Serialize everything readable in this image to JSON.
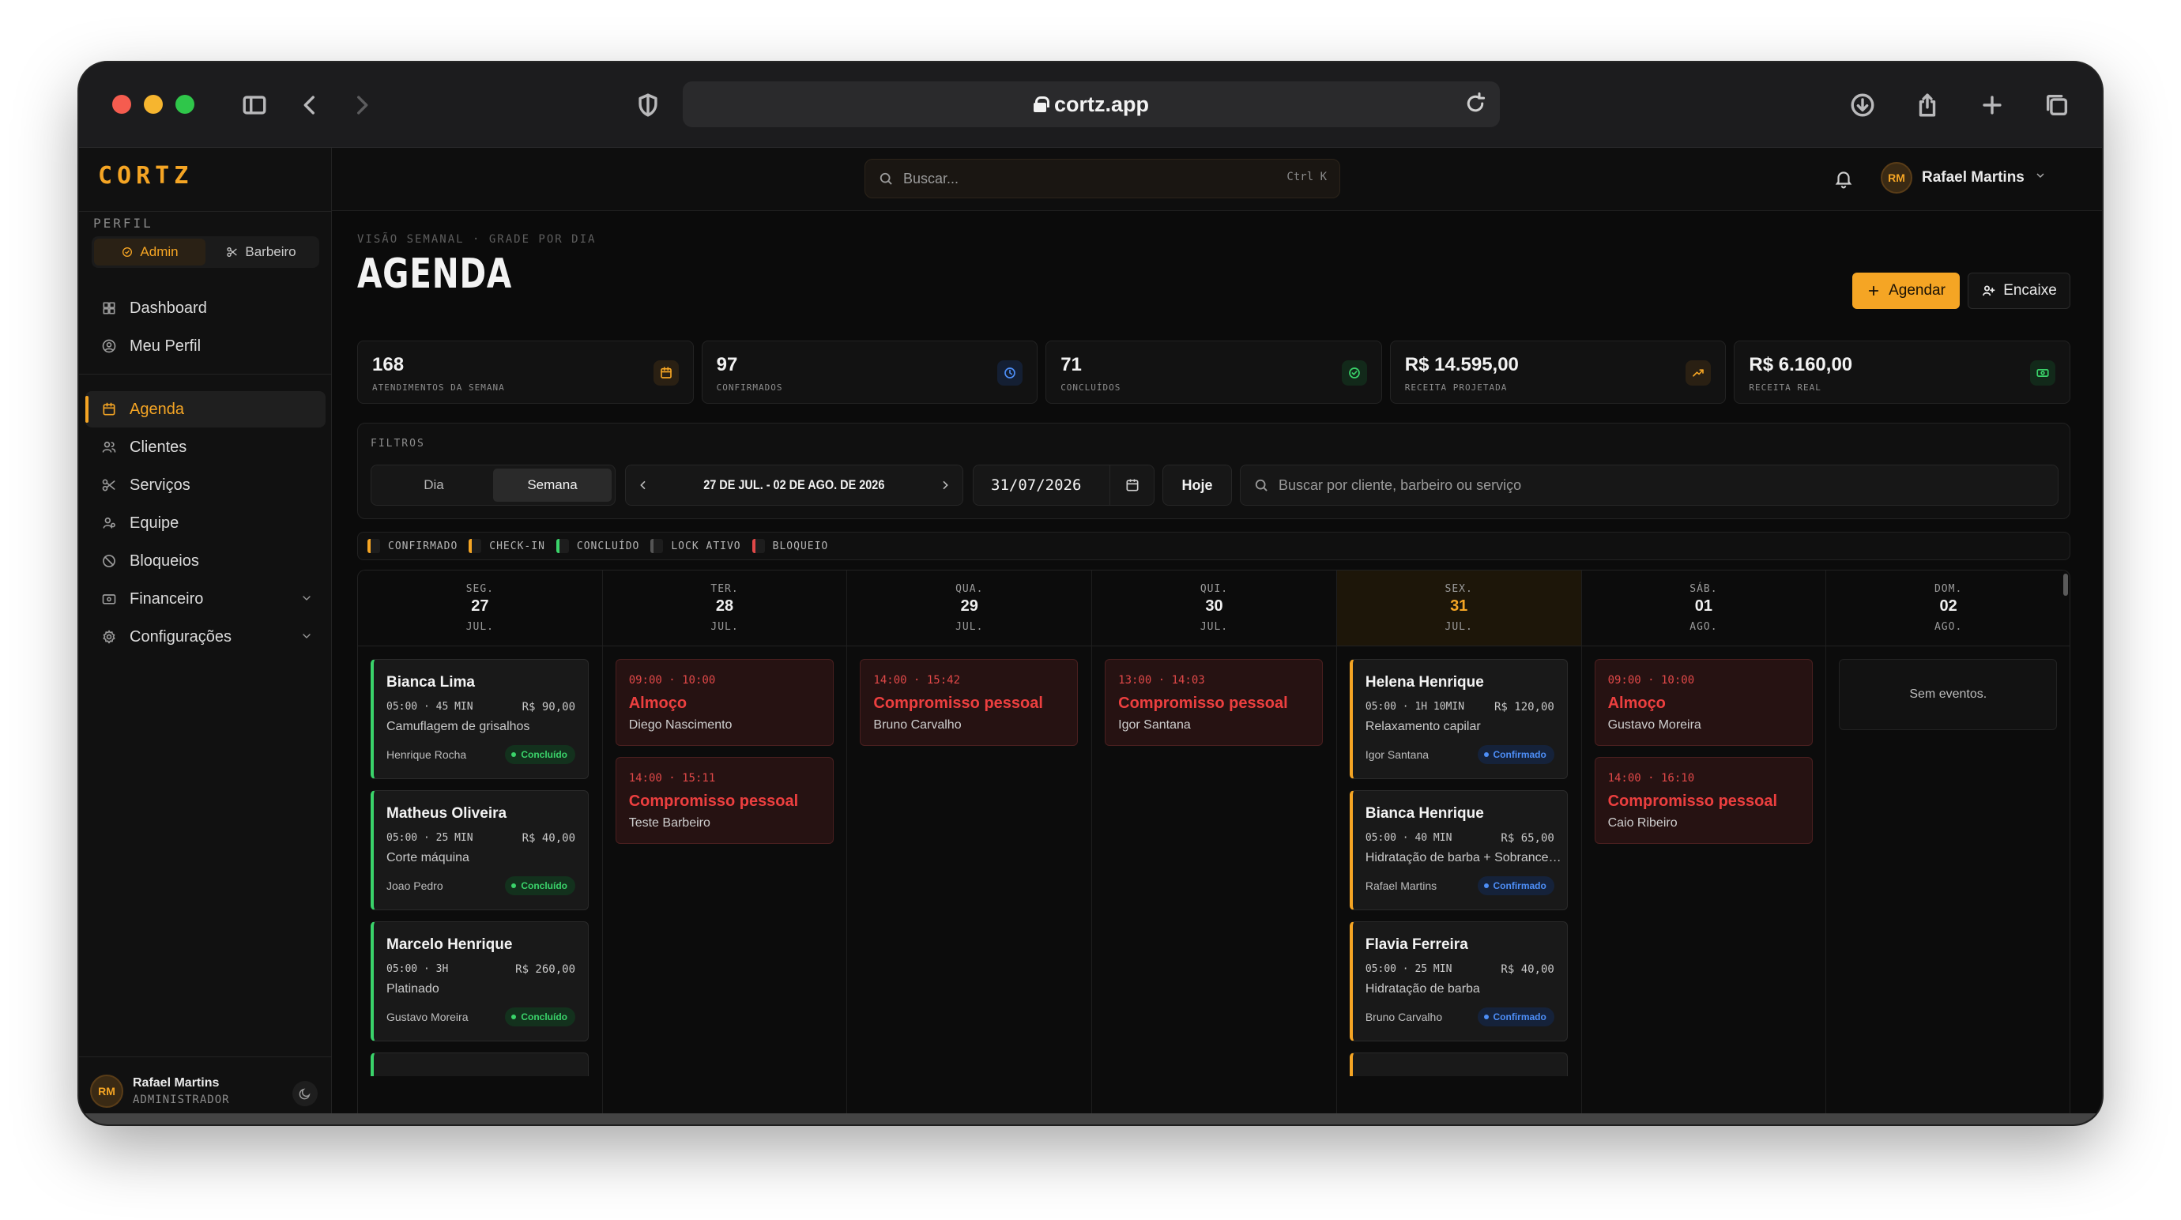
{
  "browser": {
    "url": "cortz.app",
    "icons": [
      "sidebar-toggle-icon",
      "back-icon",
      "forward-icon",
      "shield-icon",
      "reload-icon",
      "download-icon",
      "share-icon",
      "new-tab-icon",
      "tabs-overview-icon"
    ]
  },
  "app": {
    "brand": "CORTZ",
    "accent": "#f5a524"
  },
  "sidebar": {
    "profile_label": "PERFIL",
    "roles": [
      {
        "label": "Admin",
        "active": true
      },
      {
        "label": "Barbeiro",
        "active": false
      }
    ],
    "nav_top": [
      {
        "label": "Dashboard",
        "icon": "dashboard-icon"
      },
      {
        "label": "Meu Perfil",
        "icon": "user-circle-icon"
      }
    ],
    "nav_main": [
      {
        "label": "Agenda",
        "icon": "calendar-icon",
        "active": true
      },
      {
        "label": "Clientes",
        "icon": "users-icon"
      },
      {
        "label": "Serviços",
        "icon": "scissors-icon"
      },
      {
        "label": "Equipe",
        "icon": "team-icon"
      },
      {
        "label": "Bloqueios",
        "icon": "ban-icon"
      },
      {
        "label": "Financeiro",
        "icon": "wallet-icon",
        "expandable": true
      },
      {
        "label": "Configurações",
        "icon": "gear-icon",
        "expandable": true
      }
    ],
    "user": {
      "initials": "RM",
      "name": "Rafael Martins",
      "role": "ADMINISTRADOR"
    }
  },
  "topbar": {
    "search_placeholder": "Buscar...",
    "search_shortcut": "Ctrl K",
    "user": {
      "initials": "RM",
      "name": "Rafael Martins"
    }
  },
  "page": {
    "breadcrumb": "VISÃO SEMANAL · GRADE POR DIA",
    "title": "AGENDA",
    "primary_action": "Agendar",
    "secondary_action": "Encaixe"
  },
  "stats": [
    {
      "value": "168",
      "label": "ATENDIMENTOS DA SEMANA",
      "icon": "calendar-icon",
      "color": "#f5a524",
      "bg": "#2a2013"
    },
    {
      "value": "97",
      "label": "CONFIRMADOS",
      "icon": "clock-icon",
      "color": "#4d8ef7",
      "bg": "#141f33"
    },
    {
      "value": "71",
      "label": "CONCLUÍDOS",
      "icon": "check-circle-icon",
      "color": "#3ad36a",
      "bg": "#12291a"
    },
    {
      "value": "R$ 14.595,00",
      "label": "RECEITA PROJETADA",
      "icon": "trending-up-icon",
      "color": "#f5a524",
      "bg": "#2a2013"
    },
    {
      "value": "R$ 6.160,00",
      "label": "RECEITA REAL",
      "icon": "cash-icon",
      "color": "#3ad36a",
      "bg": "#12291a"
    }
  ],
  "filters": {
    "title": "FILTROS",
    "view_options": [
      {
        "label": "Dia",
        "active": false
      },
      {
        "label": "Semana",
        "active": true
      }
    ],
    "range_label": "27 DE JUL. - 02 DE AGO. DE 2026",
    "date_value": "31/07/2026",
    "today_label": "Hoje",
    "search_placeholder": "Buscar por cliente, barbeiro ou serviço"
  },
  "legend": [
    {
      "label": "CONFIRMADO",
      "color": "#f5a524"
    },
    {
      "label": "CHECK-IN",
      "color": "#f5a524"
    },
    {
      "label": "CONCLUÍDO",
      "color": "#3ad36a"
    },
    {
      "label": "LOCK ATIVO",
      "color": "#555555"
    },
    {
      "label": "BLOQUEIO",
      "color": "#e04848"
    }
  ],
  "week": [
    {
      "weekday": "SEG.",
      "day": "27",
      "month": "JUL.",
      "today": false,
      "events": [
        {
          "kind": "appt",
          "accent": "#3ad36a",
          "name": "Bianca Lima",
          "meta": "05:00 · 45 MIN",
          "price": "R$ 90,00",
          "service": "Camuflagem de grisalhos",
          "barber": "Henrique Rocha",
          "status": "Concluído",
          "status_kind": "done"
        },
        {
          "kind": "appt",
          "accent": "#3ad36a",
          "name": "Matheus Oliveira",
          "meta": "05:00 · 25 MIN",
          "price": "R$ 40,00",
          "service": "Corte máquina",
          "barber": "Joao Pedro",
          "status": "Concluído",
          "status_kind": "done"
        },
        {
          "kind": "appt",
          "accent": "#3ad36a",
          "name": "Marcelo Henrique",
          "meta": "05:00 · 3H",
          "price": "R$ 260,00",
          "service": "Platinado",
          "barber": "Gustavo Moreira",
          "status": "Concluído",
          "status_kind": "done"
        },
        {
          "kind": "peek",
          "accent": "#3ad36a"
        }
      ]
    },
    {
      "weekday": "TER.",
      "day": "28",
      "month": "JUL.",
      "today": false,
      "events": [
        {
          "kind": "block",
          "time": "09:00 · 10:00",
          "title": "Almoço",
          "who": "Diego Nascimento"
        },
        {
          "kind": "block",
          "time": "14:00 · 15:11",
          "title": "Compromisso pessoal",
          "who": "Teste Barbeiro"
        }
      ]
    },
    {
      "weekday": "QUA.",
      "day": "29",
      "month": "JUL.",
      "today": false,
      "events": [
        {
          "kind": "block",
          "time": "14:00 · 15:42",
          "title": "Compromisso pessoal",
          "who": "Bruno Carvalho"
        }
      ]
    },
    {
      "weekday": "QUI.",
      "day": "30",
      "month": "JUL.",
      "today": false,
      "events": [
        {
          "kind": "block",
          "time": "13:00 · 14:03",
          "title": "Compromisso pessoal",
          "who": "Igor Santana"
        }
      ]
    },
    {
      "weekday": "SEX.",
      "day": "31",
      "month": "JUL.",
      "today": true,
      "events": [
        {
          "kind": "appt",
          "accent": "#f5a524",
          "name": "Helena Henrique",
          "meta": "05:00 · 1H 10MIN",
          "price": "R$ 120,00",
          "service": "Relaxamento capilar",
          "barber": "Igor Santana",
          "status": "Confirmado",
          "status_kind": "conf"
        },
        {
          "kind": "appt",
          "accent": "#f5a524",
          "name": "Bianca Henrique",
          "meta": "05:00 · 40 MIN",
          "price": "R$ 65,00",
          "service": "Hidratação de barba + Sobrancelha",
          "barber": "Rafael Martins",
          "status": "Confirmado",
          "status_kind": "conf"
        },
        {
          "kind": "appt",
          "accent": "#f5a524",
          "name": "Flavia Ferreira",
          "meta": "05:00 · 25 MIN",
          "price": "R$ 40,00",
          "service": "Hidratação de barba",
          "barber": "Bruno Carvalho",
          "status": "Confirmado",
          "status_kind": "conf"
        },
        {
          "kind": "peek",
          "accent": "#f5a524"
        }
      ]
    },
    {
      "weekday": "SÁB.",
      "day": "01",
      "month": "AGO.",
      "today": false,
      "events": [
        {
          "kind": "block",
          "time": "09:00 · 10:00",
          "title": "Almoço",
          "who": "Gustavo Moreira"
        },
        {
          "kind": "block",
          "time": "14:00 · 16:10",
          "title": "Compromisso pessoal",
          "who": "Caio Ribeiro"
        }
      ]
    },
    {
      "weekday": "DOM.",
      "day": "02",
      "month": "AGO.",
      "today": false,
      "events": [
        {
          "kind": "empty",
          "text": "Sem eventos."
        }
      ]
    }
  ]
}
